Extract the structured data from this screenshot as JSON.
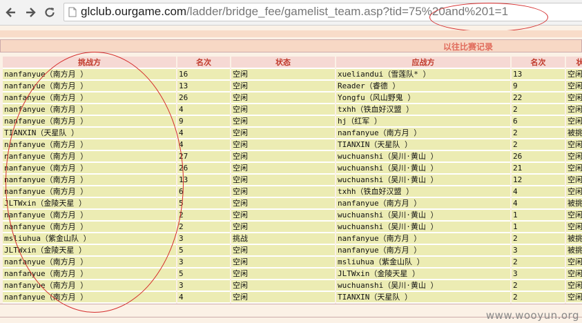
{
  "browser": {
    "url_host": "glclub.ourgame.com",
    "url_path": "/ladder/bridge_fee/gamelist_team.asp?tid=75%20and%201=1"
  },
  "section": {
    "title": "以往比赛记录"
  },
  "table": {
    "headers": [
      "挑战方",
      "名次",
      "状态",
      "应战方",
      "名次",
      "状"
    ],
    "rows": [
      [
        "nanfanyue（南方月 ）",
        "16",
        "空闲",
        "xueliandui（雪莲队* ）",
        "13",
        "空闲"
      ],
      [
        "nanfanyue（南方月 ）",
        "13",
        "空闲",
        "Reader（睿德 ）",
        "9",
        "空闲"
      ],
      [
        "nanfanyue（南方月 ）",
        "26",
        "空闲",
        "Yongfu（风山野鬼 ）",
        "22",
        "空闲"
      ],
      [
        "nanfanyue（南方月 ）",
        "4",
        "空闲",
        "txhh（铁血好汉盟 ）",
        "2",
        "空闲"
      ],
      [
        "nanfanyue（南方月 ）",
        "9",
        "空闲",
        "hj（红军 ）",
        "6",
        "空闲"
      ],
      [
        "TIANXIN（天星队 ）",
        "4",
        "空闲",
        "nanfanyue（南方月 ）",
        "2",
        "被挑"
      ],
      [
        "nanfanyue（南方月 ）",
        "4",
        "空闲",
        "TIANXIN（天星队 ）",
        "2",
        "空闲"
      ],
      [
        "nanfanyue（南方月 ）",
        "27",
        "空闲",
        "wuchuanshi（吴川·黄山 ）",
        "26",
        "空闲"
      ],
      [
        "nanfanyue（南方月 ）",
        "26",
        "空闲",
        "wuchuanshi（吴川·黄山 ）",
        "21",
        "空闲"
      ],
      [
        "nanfanyue（南方月 ）",
        "13",
        "空闲",
        "wuchuanshi（吴川·黄山 ）",
        "12",
        "空闲"
      ],
      [
        "nanfanyue（南方月 ）",
        "6",
        "空闲",
        "txhh（铁血好汉盟 ）",
        "4",
        "空闲"
      ],
      [
        "JLTWxin（金陵天星 ）",
        "5",
        "空闲",
        "nanfanyue（南方月 ）",
        "4",
        "被挑"
      ],
      [
        "nanfanyue（南方月 ）",
        "2",
        "空闲",
        "wuchuanshi（吴川·黄山 ）",
        "1",
        "空闲"
      ],
      [
        "nanfanyue（南方月 ）",
        "2",
        "空闲",
        "wuchuanshi（吴川·黄山 ）",
        "1",
        "空闲"
      ],
      [
        "msliuhua（紫金山队 ）",
        "3",
        "挑战",
        "nanfanyue（南方月 ）",
        "2",
        "被挑"
      ],
      [
        "JLTWxin（金陵天星 ）",
        "5",
        "空闲",
        "nanfanyue（南方月 ）",
        "3",
        "被挑"
      ],
      [
        "nanfanyue（南方月 ）",
        "3",
        "空闲",
        "msliuhua（紫金山队 ）",
        "2",
        "空闲"
      ],
      [
        "nanfanyue（南方月 ）",
        "5",
        "空闲",
        "JLTWxin（金陵天星 ）",
        "3",
        "空闲"
      ],
      [
        "nanfanyue（南方月 ）",
        "3",
        "空闲",
        "wuchuanshi（吴川·黄山 ）",
        "2",
        "空闲"
      ],
      [
        "nanfanyue（南方月 ）",
        "4",
        "空闲",
        "TIANXIN（天星队 ）",
        "2",
        "空闲"
      ]
    ]
  },
  "watermark": "www.wooyun.org",
  "colors": {
    "header_text": "#c0392b",
    "cell_bg": "#ececb3",
    "annotation_red": "#d42a2a"
  },
  "icons": {
    "back": "arrow-left-icon",
    "forward": "arrow-right-icon",
    "reload": "reload-icon",
    "page": "page-icon"
  }
}
